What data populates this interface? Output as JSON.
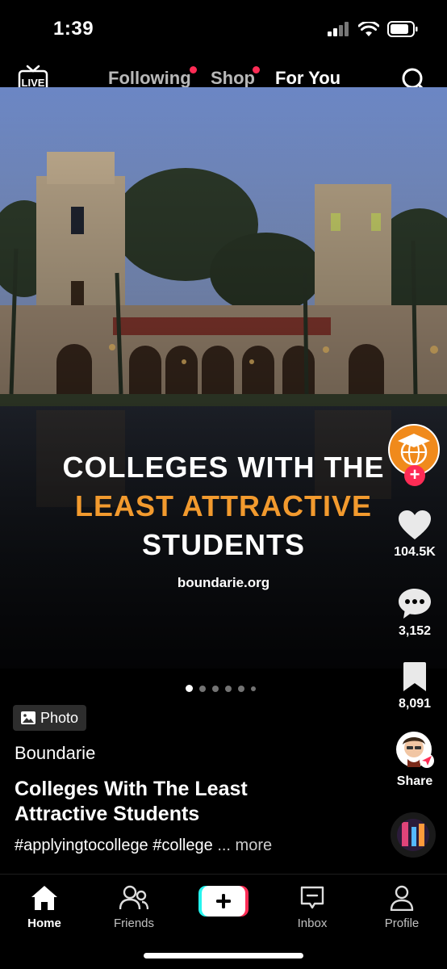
{
  "status": {
    "time": "1:39"
  },
  "top_nav": {
    "live_label": "LIVE",
    "tabs": [
      {
        "label": "Following",
        "has_dot": true
      },
      {
        "label": "Shop",
        "has_dot": true
      },
      {
        "label": "For You",
        "active": true
      }
    ]
  },
  "post": {
    "headline_line1": "COLLEGES WITH THE",
    "headline_line2": "LEAST ATTRACTIVE",
    "headline_line3": "STUDENTS",
    "site": "boundarie.org",
    "carousel": {
      "total": 6,
      "current": 1
    },
    "badge_label": "Photo",
    "username": "Boundarie",
    "title": "Colleges With The Least Attractive Students",
    "hashtags": "#applyingtocollege #college",
    "more_label": "... more"
  },
  "actions": {
    "likes": "104.5K",
    "comments": "3,152",
    "saves": "8,091",
    "share_label": "Share"
  },
  "bottom_nav": {
    "home": "Home",
    "friends": "Friends",
    "inbox": "Inbox",
    "profile": "Profile"
  },
  "colors": {
    "accent_red": "#fe2c55",
    "headline_orange": "#f29a2e",
    "avatar_orange": "#f08a1c",
    "create_cyan": "#25f4ee"
  }
}
